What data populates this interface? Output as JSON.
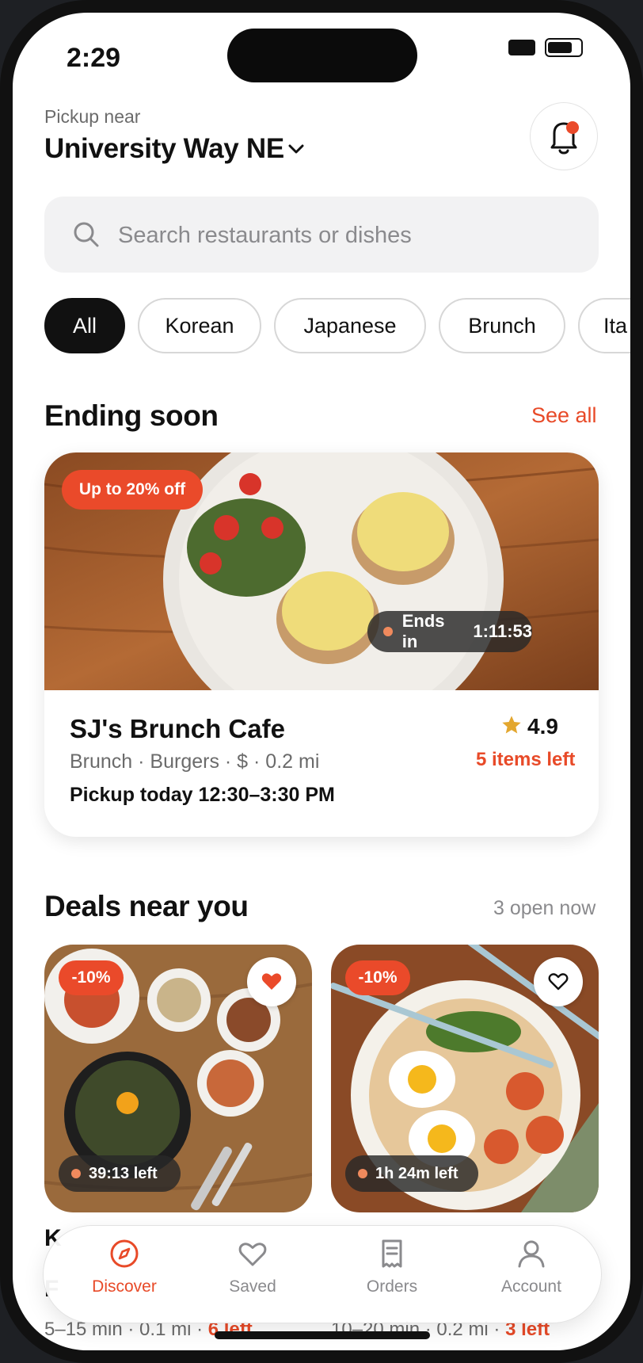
{
  "status_bar": {
    "time": "2:29"
  },
  "header": {
    "pickup_label": "Pickup near",
    "location": "University Way NE"
  },
  "search": {
    "placeholder": "Search restaurants or dishes"
  },
  "categories": [
    {
      "label": "All",
      "active": true
    },
    {
      "label": "Korean",
      "active": false
    },
    {
      "label": "Japanese",
      "active": false
    },
    {
      "label": "Brunch",
      "active": false
    },
    {
      "label": "Ita",
      "active": false
    }
  ],
  "ending_soon": {
    "title": "Ending soon",
    "see_all": "See all",
    "featured": {
      "discount": "Up to 20% off",
      "ends_label": "Ends in",
      "ends_time": "1:11:53",
      "name": "SJ's Brunch Cafe",
      "meta": "Brunch · Burgers · $ · 0.2 mi",
      "pickup": "Pickup today 12:30–3:30 PM",
      "rating": "4.9",
      "items_left": "5 items left"
    }
  },
  "deals": {
    "title": "Deals near you",
    "open_now": "3 open now",
    "cards": [
      {
        "discount": "-10%",
        "time_left": "39:13 left",
        "favorited": true,
        "name": "K",
        "name2": "F",
        "meta": "5–15 min · 0.1 mi · ",
        "left": "6 left"
      },
      {
        "discount": "-10%",
        "time_left": "1h 24m left",
        "favorited": false,
        "meta": "10–20 min · 0.2 mi · ",
        "left": "3 left"
      }
    ]
  },
  "tabbar": {
    "tabs": [
      {
        "label": "Discover",
        "icon": "compass-icon",
        "active": true
      },
      {
        "label": "Saved",
        "icon": "heart-icon",
        "active": false
      },
      {
        "label": "Orders",
        "icon": "receipt-icon",
        "active": false
      },
      {
        "label": "Account",
        "icon": "person-icon",
        "active": false
      }
    ]
  },
  "colors": {
    "accent": "#ea4a2a",
    "text": "#111111",
    "muted": "#6b6b6b"
  }
}
